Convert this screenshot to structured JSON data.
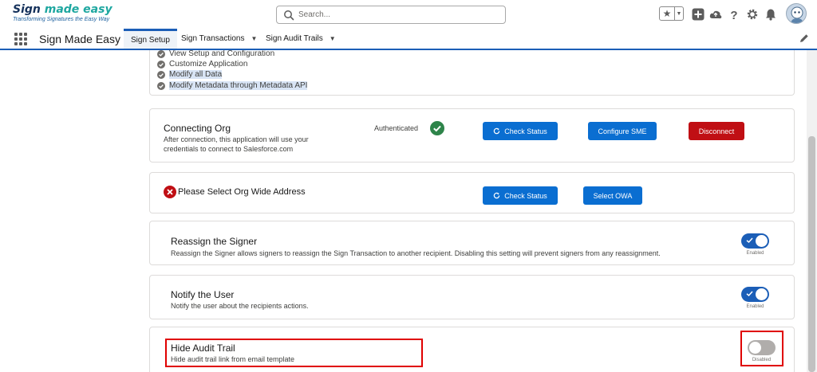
{
  "brand": {
    "name_part1": "Sign ",
    "name_part2": "made easy",
    "tagline": "Transforming Signatures the Easy Way"
  },
  "search": {
    "placeholder": "Search..."
  },
  "header_icons": [
    "star-icon",
    "chevron-down-icon",
    "plus-icon",
    "cloud-icon",
    "help-icon",
    "gear-icon",
    "bell-icon",
    "avatar"
  ],
  "nav": {
    "app_name": "Sign Made Easy",
    "tabs": [
      {
        "label": "Sign Setup",
        "active": true
      },
      {
        "label": "Sign Transactions",
        "active": false
      },
      {
        "label": "Sign Audit Trails",
        "active": false
      }
    ]
  },
  "permissions": [
    {
      "label": "View Setup and Configuration",
      "highlighted": false
    },
    {
      "label": "Customize Application",
      "highlighted": false
    },
    {
      "label": "Modify all Data",
      "highlighted": true
    },
    {
      "label": "Modify Metadata through Metadata API",
      "highlighted": true
    }
  ],
  "connecting_org": {
    "title": "Connecting Org",
    "description": "After connection, this application will use your credentials to connect to Salesforce.com",
    "status": "Authenticated",
    "buttons": {
      "check_status": "Check Status",
      "configure": "Configure SME",
      "disconnect": "Disconnect"
    }
  },
  "org_wide": {
    "message": "Please Select Org Wide Address",
    "buttons": {
      "check_status": "Check Status",
      "select": "Select OWA"
    }
  },
  "settings": [
    {
      "title": "Reassign the Signer",
      "description": "Reassign the Signer allows signers to reassign the Sign Transaction to another recipient. Disabling this setting will prevent signers from any reassignment.",
      "enabled": true,
      "state_label": "Enabled"
    },
    {
      "title": "Notify the User",
      "description": "Notify the user about the recipients actions.",
      "enabled": true,
      "state_label": "Enabled"
    },
    {
      "title": "Hide Audit Trail",
      "description": "Hide audit trail link from email template",
      "enabled": false,
      "state_label": "Disabled"
    }
  ],
  "colors": {
    "brand_blue": "#0a6ed1",
    "toggle_on": "#1b5eb7",
    "danger": "#c00f14",
    "success": "#2e844a",
    "annotation_red": "#e00000"
  }
}
